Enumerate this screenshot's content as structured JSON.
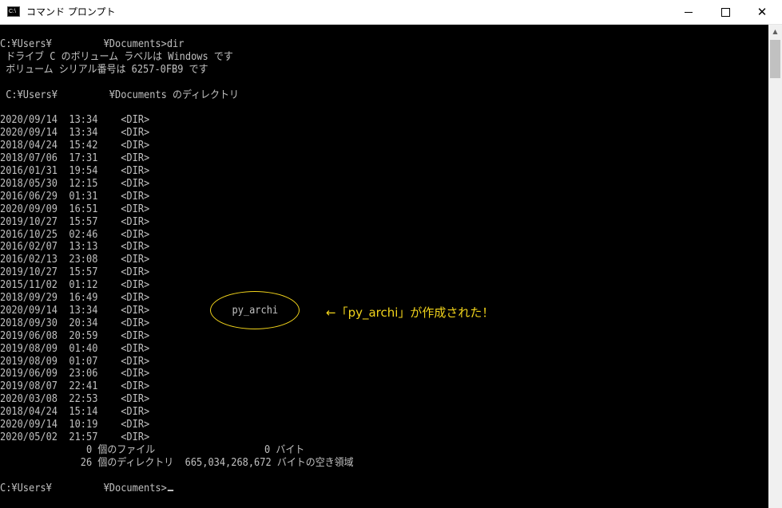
{
  "window": {
    "title": "コマンド プロンプト",
    "minimize": "minimize",
    "maximize": "maximize",
    "close": "close"
  },
  "console": {
    "lines": [
      "C:¥Users¥         ¥Documents>dir",
      " ドライブ C のボリューム ラベルは Windows です",
      " ボリューム シリアル番号は 6257-0FB9 です",
      "",
      " C:¥Users¥         ¥Documents のディレクトリ",
      "",
      "2020/09/14  13:34    <DIR>",
      "2020/09/14  13:34    <DIR>",
      "2018/04/24  15:42    <DIR>",
      "2018/07/06  17:31    <DIR>",
      "2016/01/31  19:54    <DIR>",
      "2018/05/30  12:15    <DIR>",
      "2016/06/29  01:31    <DIR>",
      "2020/09/09  16:51    <DIR>",
      "2019/10/27  15:57    <DIR>",
      "2016/10/25  02:46    <DIR>",
      "2016/02/07  13:13    <DIR>",
      "2016/02/13  23:08    <DIR>",
      "2019/10/27  15:57    <DIR>",
      "2015/11/02  01:12    <DIR>",
      "2018/09/29  16:49    <DIR>",
      "2020/09/14  13:34    <DIR>",
      "2018/09/30  20:34    <DIR>",
      "2019/06/08  20:59    <DIR>",
      "2019/08/09  01:40    <DIR>",
      "2019/08/09  01:07    <DIR>",
      "2019/06/09  23:06    <DIR>",
      "2019/08/07  22:41    <DIR>",
      "2020/03/08  22:53    <DIR>",
      "2018/04/24  15:14    <DIR>",
      "2020/09/14  10:19    <DIR>",
      "2020/05/02  21:57    <DIR>",
      "               0 個のファイル                   0 バイト",
      "              26 個のディレクトリ  665,034,268,672 バイトの空き領域",
      "",
      "C:¥Users¥         ¥Documents>"
    ]
  },
  "annotation": {
    "highlighted_item": "py_archi",
    "note": "←「py_archi」が作成された！",
    "color": "#f2d41b"
  },
  "colors": {
    "console_background": "#000000",
    "console_text": "#c0c0c0",
    "titlebar_background": "#ffffff"
  }
}
